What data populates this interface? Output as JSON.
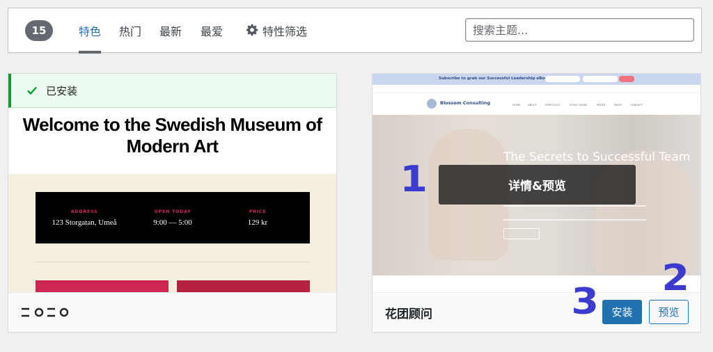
{
  "filter_bar": {
    "count": "15",
    "tabs": [
      {
        "label": "特色",
        "active": true
      },
      {
        "label": "热门",
        "active": false
      },
      {
        "label": "最新",
        "active": false
      },
      {
        "label": "最爱",
        "active": false
      }
    ],
    "feature_filter_label": "特性筛选",
    "search_placeholder": "搜索主题..."
  },
  "themes": [
    {
      "name": "2020",
      "installed_label": "已安装",
      "screenshot": {
        "title": "Welcome to the Swedish Museum of Modern Art",
        "info": [
          {
            "label": "ADDRESS",
            "value": "123 Storgatan, Umeå"
          },
          {
            "label": "OPEN TODAY",
            "value": "9:00 — 5:00"
          },
          {
            "label": "PRICE",
            "value": "129 kr"
          }
        ]
      }
    },
    {
      "name": "花团顾问",
      "details_label": "详情&预览",
      "install_label": "安装",
      "preview_label": "预览",
      "screenshot": {
        "announcement": "Subscribe to grab our Successful Leadership eBook!",
        "brand": "Blossom Consulting",
        "nav": [
          "HOME",
          "ABOUT",
          "PORTFOLIO",
          "STYLE GUIDE",
          "PAGES",
          "SHOP",
          "CONTACT"
        ],
        "hero_title": "The Secrets to Successful Team"
      }
    }
  ],
  "annotations": [
    "1",
    "2",
    "3"
  ],
  "colors": {
    "accent": "#2271b1",
    "installed_green": "#00a32a",
    "mark_blue": "#3b3ccf"
  }
}
